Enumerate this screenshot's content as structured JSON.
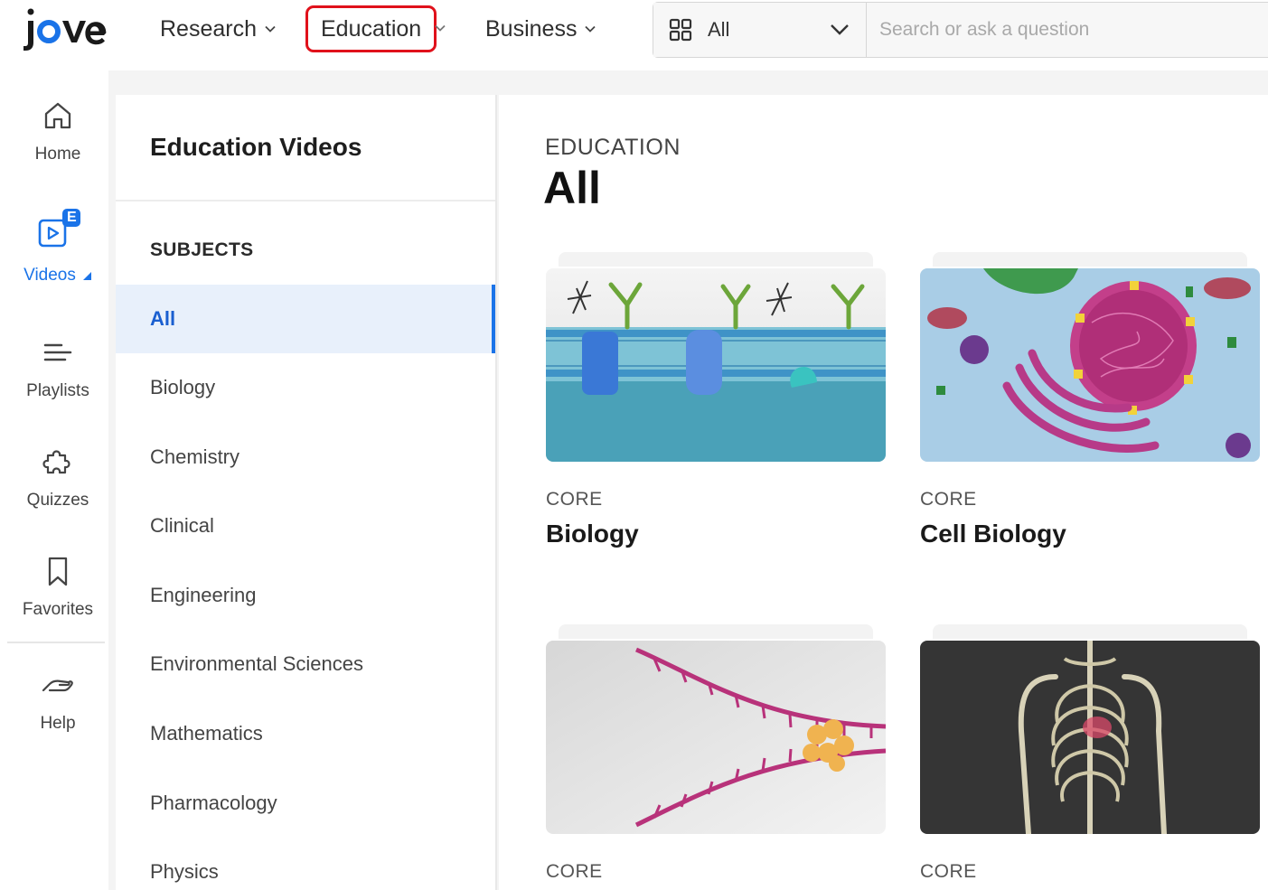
{
  "brand": {
    "logo_text": "jove",
    "accent": "#1a73e8",
    "highlight": "#e0111b"
  },
  "nav": {
    "research": "Research",
    "education": "Education",
    "business": "Business"
  },
  "search": {
    "scope": "All",
    "placeholder": "Search or ask a question"
  },
  "rail": {
    "home": "Home",
    "videos": "Videos",
    "videos_badge": "E",
    "playlists": "Playlists",
    "quizzes": "Quizzes",
    "favorites": "Favorites",
    "help": "Help"
  },
  "panel": {
    "title": "Education Videos",
    "section": "SUBJECTS",
    "subjects": [
      "All",
      "Biology",
      "Chemistry",
      "Clinical",
      "Engineering",
      "Environmental Sciences",
      "Mathematics",
      "Pharmacology",
      "Physics"
    ]
  },
  "main": {
    "breadcrumb": "EDUCATION",
    "title": "All",
    "cards": [
      {
        "tag": "CORE",
        "name": "Biology"
      },
      {
        "tag": "CORE",
        "name": "Cell Biology"
      },
      {
        "tag": "CORE",
        "name": ""
      },
      {
        "tag": "CORE",
        "name": ""
      }
    ]
  }
}
